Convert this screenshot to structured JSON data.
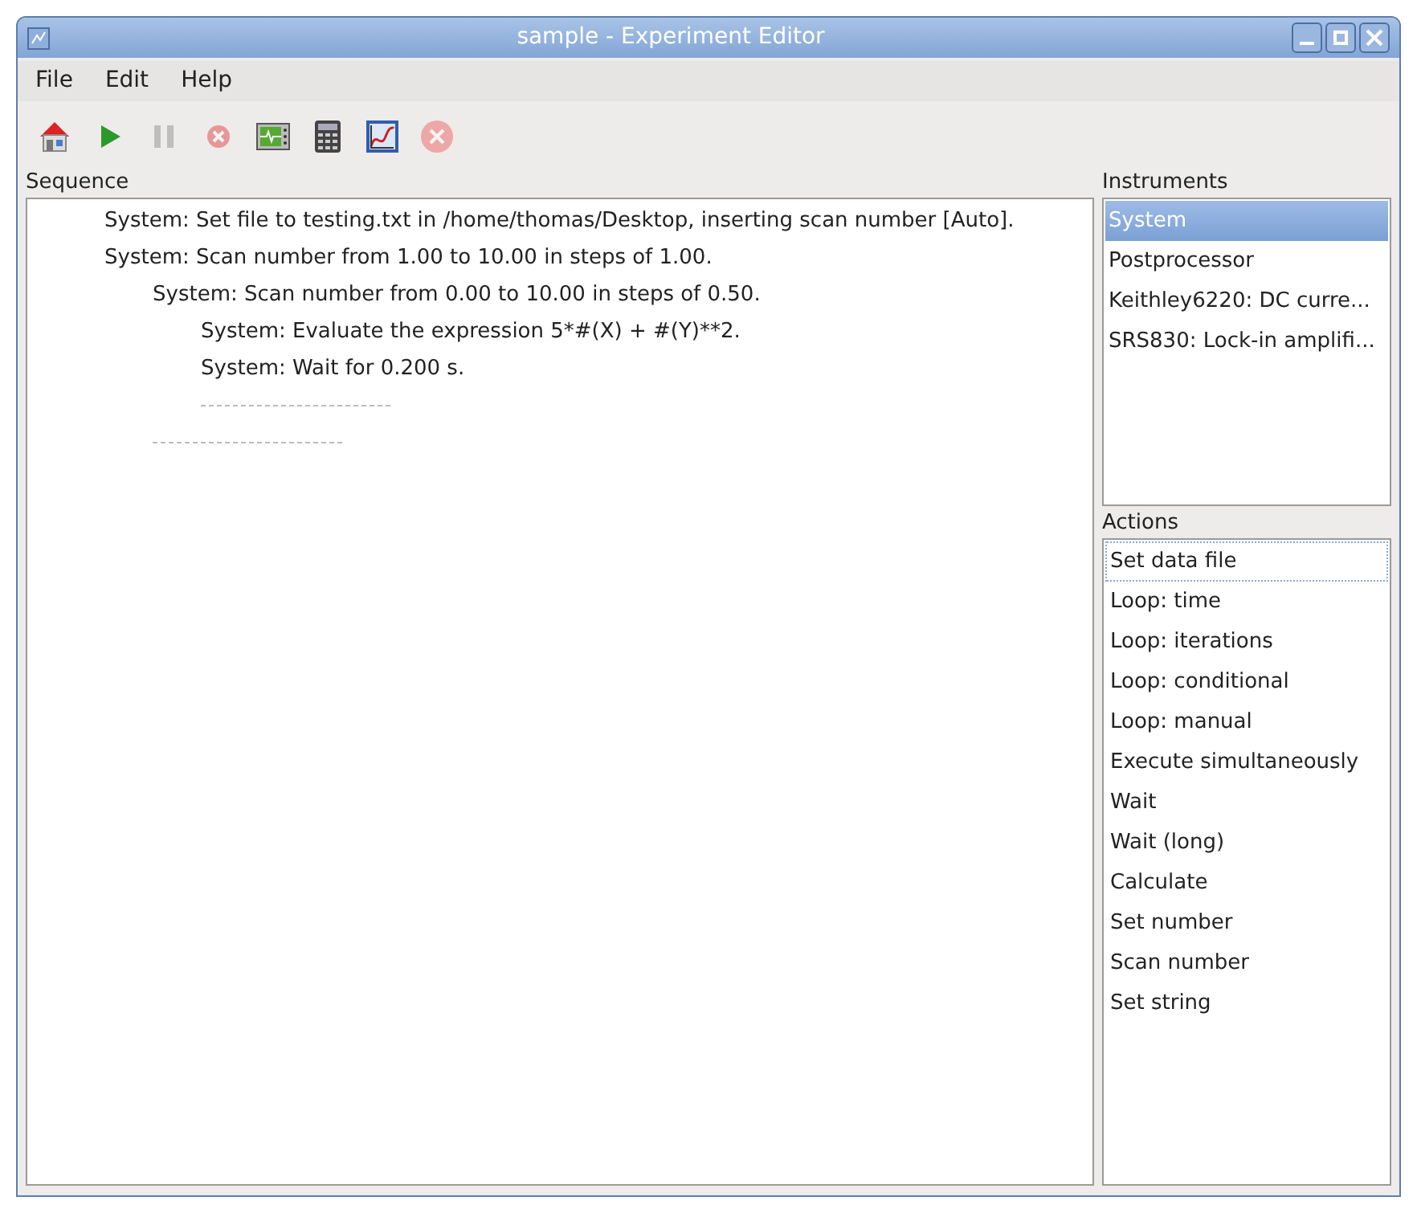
{
  "window": {
    "title": "sample - Experiment Editor"
  },
  "menu": [
    "File",
    "Edit",
    "Help"
  ],
  "toolbar": [
    {
      "kind": "home",
      "disabled": false
    },
    {
      "kind": "run",
      "disabled": false
    },
    {
      "kind": "pause",
      "disabled": true
    },
    {
      "kind": "stop",
      "disabled": true
    },
    {
      "kind": "monitor",
      "disabled": false
    },
    {
      "kind": "calculator",
      "disabled": false
    },
    {
      "kind": "plot",
      "disabled": false
    },
    {
      "kind": "close",
      "disabled": true
    }
  ],
  "sequence": {
    "title": "Sequence",
    "items": [
      {
        "kind": "action",
        "text": "System: Set file to testing.txt in /home/thomas/Desktop, inserting scan number [Auto]."
      },
      {
        "kind": "loop",
        "text": "System: Scan number from 1.00 to 10.00 in steps of 1.00.",
        "children": [
          {
            "kind": "loop",
            "text": "System: Scan number from 0.00 to 10.00 in steps of 0.50.",
            "children": [
              {
                "kind": "action",
                "text": "System: Evaluate the expression 5*#(X) + #(Y)**2."
              },
              {
                "kind": "action",
                "text": "System: Wait for 0.200 s."
              }
            ]
          }
        ]
      }
    ]
  },
  "instruments": {
    "title": "Instruments",
    "items": [
      {
        "label": "System",
        "selected": true
      },
      {
        "label": "Postprocessor",
        "selected": false
      },
      {
        "label": "Keithley6220: DC curre...",
        "selected": false
      },
      {
        "label": "SRS830: Lock-in amplifi...",
        "selected": false
      }
    ]
  },
  "actions": {
    "title": "Actions",
    "items": [
      {
        "label": "Set data file",
        "focused": true
      },
      {
        "label": "Loop: time",
        "focused": false
      },
      {
        "label": "Loop: iterations",
        "focused": false
      },
      {
        "label": "Loop: conditional",
        "focused": false
      },
      {
        "label": "Loop: manual",
        "focused": false
      },
      {
        "label": "Execute simultaneously",
        "focused": false
      },
      {
        "label": "Wait",
        "focused": false
      },
      {
        "label": "Wait (long)",
        "focused": false
      },
      {
        "label": "Calculate",
        "focused": false
      },
      {
        "label": "Set number",
        "focused": false
      },
      {
        "label": "Scan number",
        "focused": false
      },
      {
        "label": "Set string",
        "focused": false
      }
    ]
  }
}
